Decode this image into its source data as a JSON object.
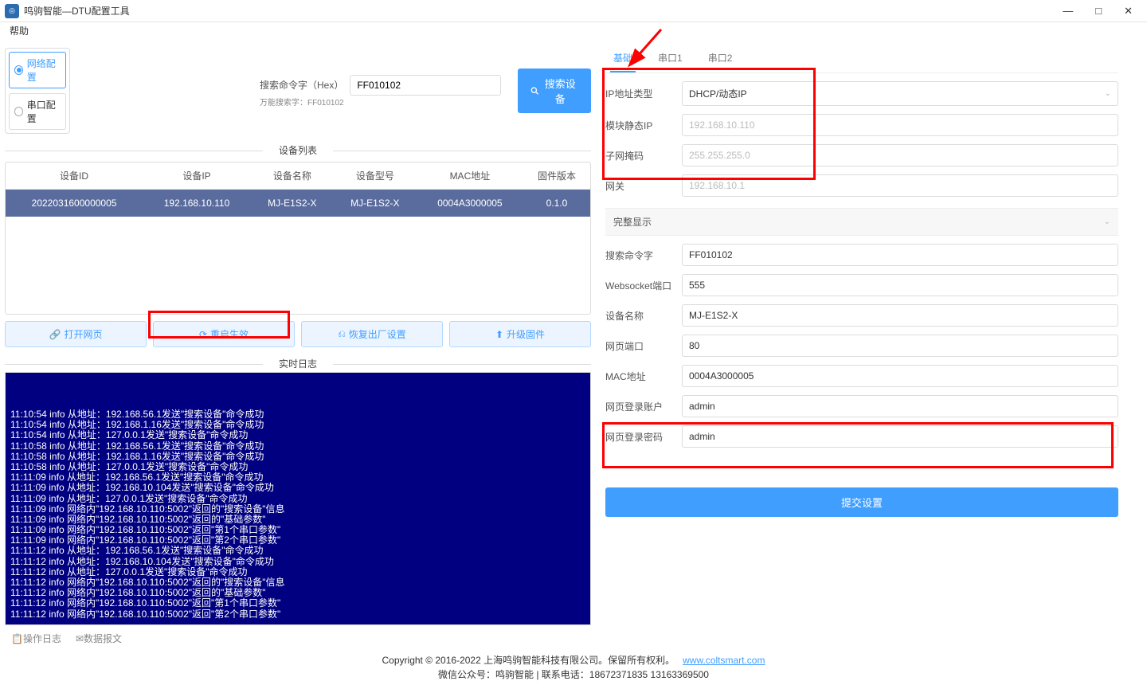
{
  "window": {
    "title": "鸣驹智能—DTU配置工具"
  },
  "menu": {
    "help": "帮助"
  },
  "winctrl": {
    "min": "—",
    "max": "□",
    "close": "✕"
  },
  "sidebar": {
    "net": "网络配置",
    "serial": "串口配置"
  },
  "search": {
    "label": "搜索命令字（Hex）",
    "sub": "万能搜索字：FF010102",
    "value": "FF010102",
    "btn": "搜索设备"
  },
  "panel": {
    "devlist": "设备列表",
    "log": "实时日志"
  },
  "table": {
    "headers": [
      "设备ID",
      "设备IP",
      "设备名称",
      "设备型号",
      "MAC地址",
      "固件版本"
    ],
    "row": [
      "2022031600000005",
      "192.168.10.110",
      "MJ-E1S2-X",
      "MJ-E1S2-X",
      "0004A3000005",
      "0.1.0"
    ]
  },
  "actions": {
    "openweb": "打开网页",
    "reboot": "重启生效",
    "factory": "恢复出厂设置",
    "upgrade": "升级固件"
  },
  "logs": [
    "11:10:54 info 从地址：192.168.56.1发送\"搜索设备\"命令成功",
    "11:10:54 info 从地址：192.168.1.16发送\"搜索设备\"命令成功",
    "11:10:54 info 从地址：127.0.0.1发送\"搜索设备\"命令成功",
    "11:10:58 info 从地址：192.168.56.1发送\"搜索设备\"命令成功",
    "11:10:58 info 从地址：192.168.1.16发送\"搜索设备\"命令成功",
    "11:10:58 info 从地址：127.0.0.1发送\"搜索设备\"命令成功",
    "11:11:09 info 从地址：192.168.56.1发送\"搜索设备\"命令成功",
    "11:11:09 info 从地址：192.168.10.104发送\"搜索设备\"命令成功",
    "11:11:09 info 从地址：127.0.0.1发送\"搜索设备\"命令成功",
    "11:11:09 info 网络内\"192.168.10.110:5002\"返回的\"搜索设备\"信息",
    "11:11:09 info 网络内\"192.168.10.110:5002\"返回的\"基础参数\"",
    "11:11:09 info 网络内\"192.168.10.110:5002\"返回\"第1个串口参数\"",
    "11:11:09 info 网络内\"192.168.10.110:5002\"返回\"第2个串口参数\"",
    "11:11:12 info 从地址：192.168.56.1发送\"搜索设备\"命令成功",
    "11:11:12 info 从地址：192.168.10.104发送\"搜索设备\"命令成功",
    "11:11:12 info 从地址：127.0.0.1发送\"搜索设备\"命令成功",
    "11:11:12 info 网络内\"192.168.10.110:5002\"返回的\"搜索设备\"信息",
    "11:11:12 info 网络内\"192.168.10.110:5002\"返回的\"基础参数\"",
    "11:11:12 info 网络内\"192.168.10.110:5002\"返回\"第1个串口参数\"",
    "11:11:12 info 网络内\"192.168.10.110:5002\"返回\"第2个串口参数\""
  ],
  "logtabs": {
    "op": "操作日志",
    "data": "数据报文"
  },
  "rtabs": {
    "basic": "基础",
    "s1": "串口1",
    "s2": "串口2"
  },
  "form": {
    "iptype": {
      "label": "IP地址类型",
      "value": "DHCP/动态IP"
    },
    "staticip": {
      "label": "模块静态IP",
      "placeholder": "192.168.10.110"
    },
    "mask": {
      "label": "子网掩码",
      "placeholder": "255.255.255.0"
    },
    "gateway": {
      "label": "网关",
      "placeholder": "192.168.10.1"
    },
    "collapse": "完整显示",
    "searchcmd": {
      "label": "搜索命令字",
      "value": "FF010102"
    },
    "wsport": {
      "label": "Websocket端口",
      "value": "555"
    },
    "devname": {
      "label": "设备名称",
      "value": "MJ-E1S2-X"
    },
    "webport": {
      "label": "网页端口",
      "value": "80"
    },
    "mac": {
      "label": "MAC地址",
      "value": "0004A3000005"
    },
    "user": {
      "label": "网页登录账户",
      "value": "admin"
    },
    "pass": {
      "label": "网页登录密码",
      "value": "admin"
    },
    "submit": "提交设置"
  },
  "footer": {
    "l1a": "Copyright © 2016-2022 上海鸣驹智能科技有限公司。保留所有权利。",
    "link": "www.coltsmart.com",
    "l2": "微信公众号：鸣驹智能 | 联系电话：18672371835 13163369500"
  }
}
